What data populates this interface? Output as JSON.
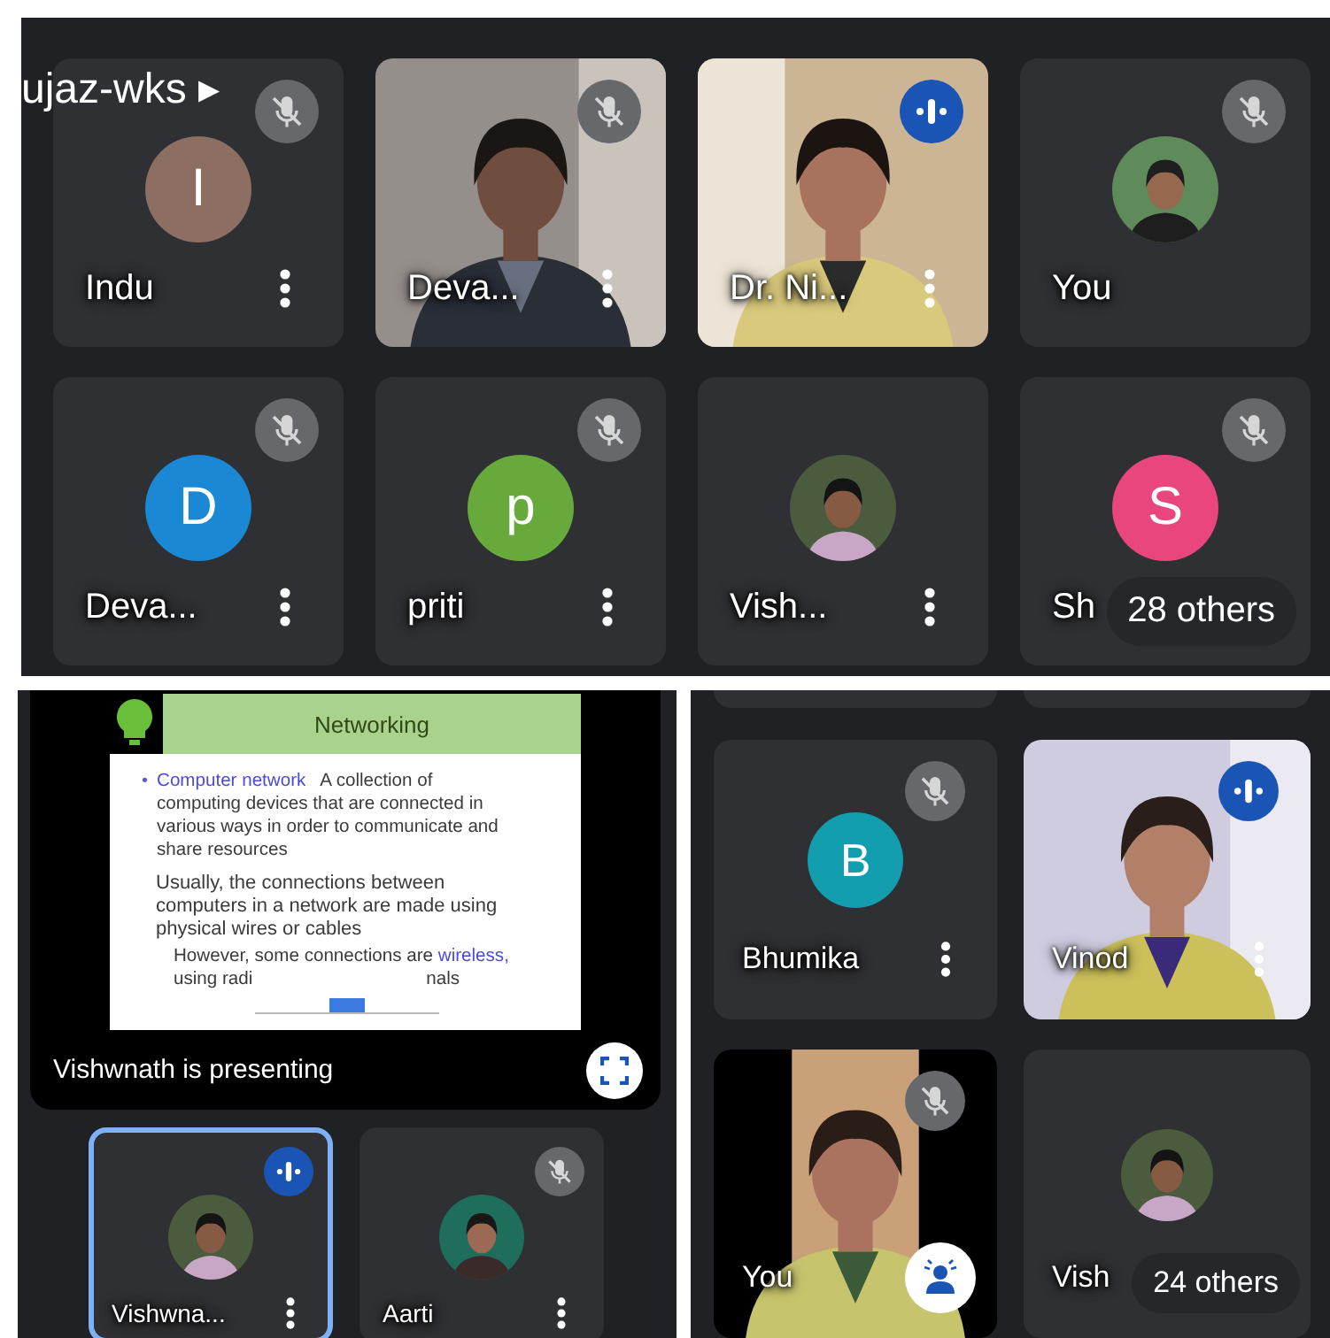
{
  "top_panel": {
    "meeting_name": "ujaz-wks",
    "menu_arrow": "▸",
    "tiles": [
      {
        "kind": "initial",
        "initial": "I",
        "color": "#8d6e63",
        "name": "Indu",
        "muted": true,
        "speaking": false,
        "more": true
      },
      {
        "kind": "video",
        "name": "Deva...",
        "muted": true,
        "speaking": false,
        "more": true
      },
      {
        "kind": "video",
        "name": "Dr. Ni...",
        "muted": false,
        "speaking": true,
        "more": true
      },
      {
        "name": "You",
        "muted": true,
        "speaking": false,
        "more": false
      },
      {
        "kind": "initial",
        "initial": "D",
        "color": "#1a88d4",
        "name": "Deva...",
        "muted": true,
        "speaking": false,
        "more": true
      },
      {
        "kind": "initial",
        "initial": "p",
        "color": "#68a93c",
        "name": "priti",
        "muted": true,
        "speaking": false,
        "more": true
      },
      {
        "name": "Vish...",
        "muted": false,
        "speaking": false,
        "more": true
      },
      {
        "kind": "initial",
        "initial": "S",
        "color": "#e8467c",
        "name": "Sh",
        "muted": true,
        "speaking": false,
        "more": false,
        "others": "28 others"
      }
    ]
  },
  "presentation": {
    "slide": {
      "title": "Networking",
      "bullet": "•",
      "term": "Computer network",
      "definition": "A collection of computing devices that are connected in various ways in order to communicate and share resources",
      "paragraph": "Usually, the connections between computers in a network are made using physical wires or cables",
      "note_start": "However, some connections are",
      "note_term": "wireless,",
      "note_cut_start": "using radi",
      "note_cut_end": "nals"
    },
    "caption": "Vishwnath is presenting"
  },
  "side_tiles": [
    {
      "name": "Vishwna...",
      "muted": false,
      "speaking": true,
      "more": true,
      "selected": true
    },
    {
      "name": "Aarti",
      "muted": true,
      "speaking": false,
      "more": true,
      "selected": false
    }
  ],
  "right_panel": {
    "tiles": [
      {
        "kind": "initial",
        "initial": "B",
        "color": "#129eaf",
        "name": "Bhumika",
        "muted": true,
        "speaking": false,
        "more": true,
        "effects": false
      },
      {
        "kind": "video",
        "name": "Vinod",
        "muted": false,
        "speaking": true,
        "more": true,
        "effects": false
      },
      {
        "kind": "video",
        "name": "You",
        "muted": true,
        "speaking": false,
        "more": false,
        "effects": true
      },
      {
        "name": "Vish",
        "muted": false,
        "speaking": false,
        "more": false,
        "effects": false,
        "others": "24 others"
      }
    ]
  }
}
